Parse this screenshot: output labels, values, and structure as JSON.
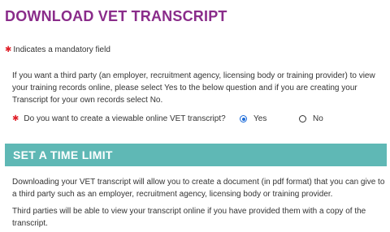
{
  "page": {
    "title": "DOWNLOAD VET TRANSCRIPT",
    "required_note": "Indicates a mandatory field",
    "intro": "If you want a third party (an employer, recruitment agency, licensing body or training provider) to view your training records online, please select Yes to the below question and if you are creating your Transcript for your own records select No."
  },
  "question": {
    "label": "Do you want to create a viewable online VET transcript?",
    "options": [
      {
        "label": "Yes",
        "selected": true
      },
      {
        "label": "No",
        "selected": false
      }
    ]
  },
  "section": {
    "title": "SET A TIME LIMIT",
    "paragraphs": [
      "Downloading your VET transcript will allow you to create a document (in pdf format) that you can give to a third party such as an employer, recruitment agency, licensing body or training provider.",
      "Third parties will be able to view your transcript online if you have provided them with a copy of the transcript."
    ]
  },
  "colors": {
    "title": "#8a2c8a",
    "required_icon": "#e0212a",
    "section_band": "#5fb8b5",
    "radio_selected": "#1a6ad8"
  },
  "icons": {
    "required": "maple-leaf-icon"
  }
}
